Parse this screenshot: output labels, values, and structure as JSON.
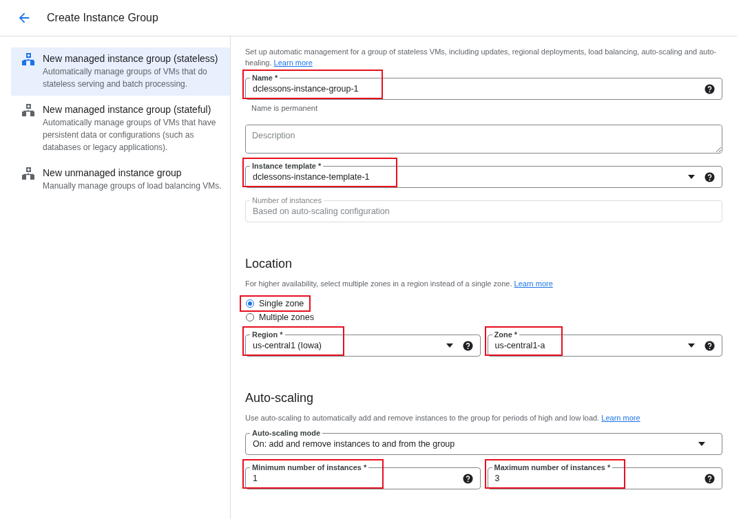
{
  "header": {
    "title": "Create Instance Group"
  },
  "sidebar": {
    "items": [
      {
        "title": "New managed instance group (stateless)",
        "description": "Automatically manage groups of VMs that do stateless serving and batch processing.",
        "selected": true
      },
      {
        "title": "New managed instance group (stateful)",
        "description": "Automatically manage groups of VMs that have persistent data or configurations (such as databases or legacy applications).",
        "selected": false
      },
      {
        "title": "New unmanaged instance group",
        "description": "Manually manage groups of load balancing VMs.",
        "selected": false
      }
    ]
  },
  "general": {
    "intro": "Set up automatic management for a group of stateless VMs, including updates, regional deployments, load balancing, auto-scaling and auto-healing.",
    "link": "Learn more",
    "rows": [
      [
        {
          "kind": "text",
          "label": "Name *",
          "value": "dclessons-instance-group-1",
          "help": true,
          "highlighted": true,
          "hint": "Name is permanent"
        }
      ],
      [
        {
          "kind": "textarea",
          "placeholder": "Description",
          "help": false,
          "highlighted": false
        }
      ],
      [
        {
          "kind": "select",
          "label": "Instance template *",
          "value": "dclessons-instance-template-1",
          "help": true,
          "highlighted": true
        }
      ],
      [
        {
          "kind": "readonly",
          "label": "Number of instances",
          "value": "Based on auto-scaling configuration",
          "help": false,
          "highlighted": false
        }
      ]
    ]
  },
  "location": {
    "heading": "Location",
    "description": "For higher availability, select multiple zones in a region instead of a single zone.",
    "link": "Learn more",
    "options": [
      {
        "label": "Single zone",
        "selected": true,
        "highlighted": true
      },
      {
        "label": "Multiple zones",
        "selected": false,
        "highlighted": false
      }
    ],
    "rows": [
      [
        {
          "kind": "select",
          "label": "Region *",
          "value": "us-central1 (Iowa)",
          "help": true,
          "highlighted": true
        },
        {
          "kind": "select",
          "label": "Zone *",
          "value": "us-central1-a",
          "help": true,
          "highlighted": true
        }
      ]
    ]
  },
  "autoscaling": {
    "heading": "Auto-scaling",
    "description": "Use auto-scaling to automatically add and remove instances to the group for periods of high and low load.",
    "link": "Learn more",
    "rows": [
      [
        {
          "kind": "select",
          "label": "Auto-scaling mode",
          "value": "On: add and remove instances to and from the group",
          "help": false,
          "highlighted": false
        }
      ],
      [
        {
          "kind": "text",
          "label": "Minimum number of instances *",
          "value": "1",
          "help": true,
          "highlighted": true
        },
        {
          "kind": "text",
          "label": "Maximum number of instances *",
          "value": "3",
          "help": true,
          "highlighted": true
        }
      ]
    ]
  }
}
